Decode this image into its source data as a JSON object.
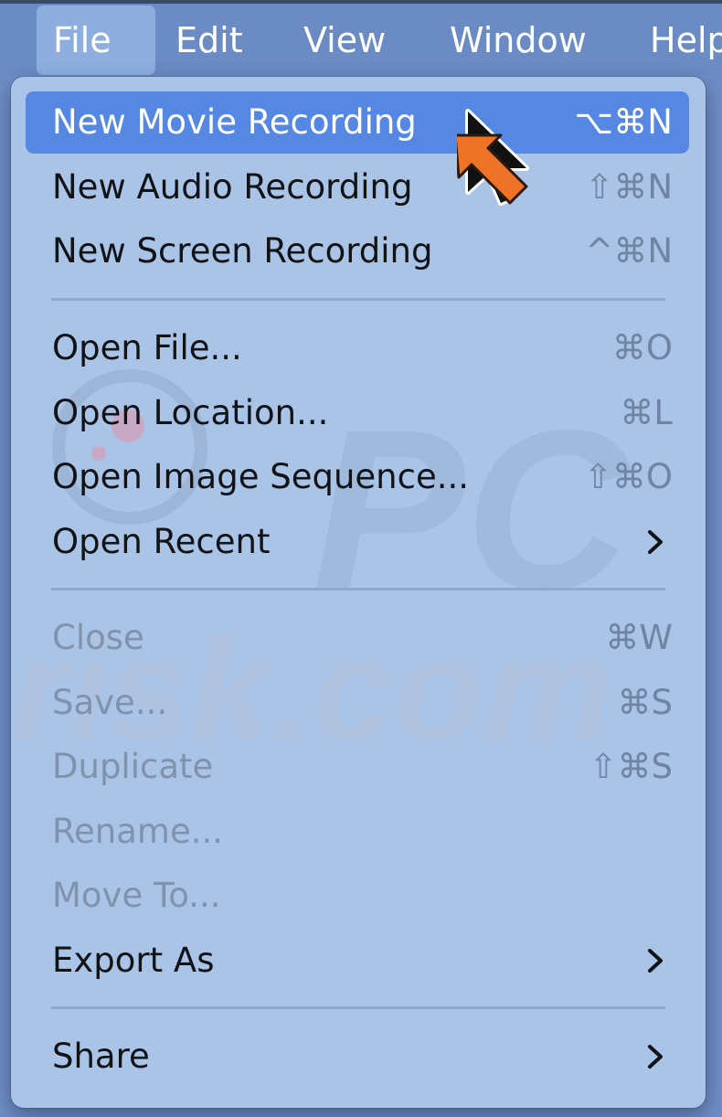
{
  "menubar": {
    "items": [
      {
        "label": "File",
        "active": true
      },
      {
        "label": "Edit",
        "active": false
      },
      {
        "label": "View",
        "active": false
      },
      {
        "label": "Window",
        "active": false
      },
      {
        "label": "Help",
        "active": false
      }
    ]
  },
  "menu": {
    "items": [
      {
        "label": "New Movie Recording",
        "shortcut": "⌥⌘N",
        "highlighted": true,
        "enabled": true
      },
      {
        "label": "New Audio Recording",
        "shortcut": "⇧⌘N",
        "enabled": true
      },
      {
        "label": "New Screen Recording",
        "shortcut": "^⌘N",
        "enabled": true
      },
      {
        "label": "Open File...",
        "shortcut": "⌘O",
        "enabled": true
      },
      {
        "label": "Open Location...",
        "shortcut": "⌘L",
        "enabled": true
      },
      {
        "label": "Open Image Sequence...",
        "shortcut": "⇧⌘O",
        "enabled": true
      },
      {
        "label": "Open Recent",
        "submenu": true,
        "enabled": true
      },
      {
        "label": "Close",
        "shortcut": "⌘W",
        "enabled": false
      },
      {
        "label": "Save...",
        "shortcut": "⌘S",
        "enabled": false
      },
      {
        "label": "Duplicate",
        "shortcut": "⇧⌘S",
        "enabled": false
      },
      {
        "label": "Rename...",
        "enabled": false
      },
      {
        "label": "Move To...",
        "enabled": false
      },
      {
        "label": "Export As",
        "submenu": true,
        "enabled": true
      },
      {
        "label": "Share",
        "submenu": true,
        "enabled": true
      }
    ]
  },
  "watermark": {
    "text": "risk.com"
  },
  "icons": {
    "pointer": "orange-arrow-pointer-icon",
    "cursor": "mouse-cursor-icon",
    "submenu": "chevron-right-icon"
  },
  "colors": {
    "highlight": "#5587e3",
    "menu_background": "#a9c4e6",
    "pointer_arrow": "#ee7326"
  }
}
